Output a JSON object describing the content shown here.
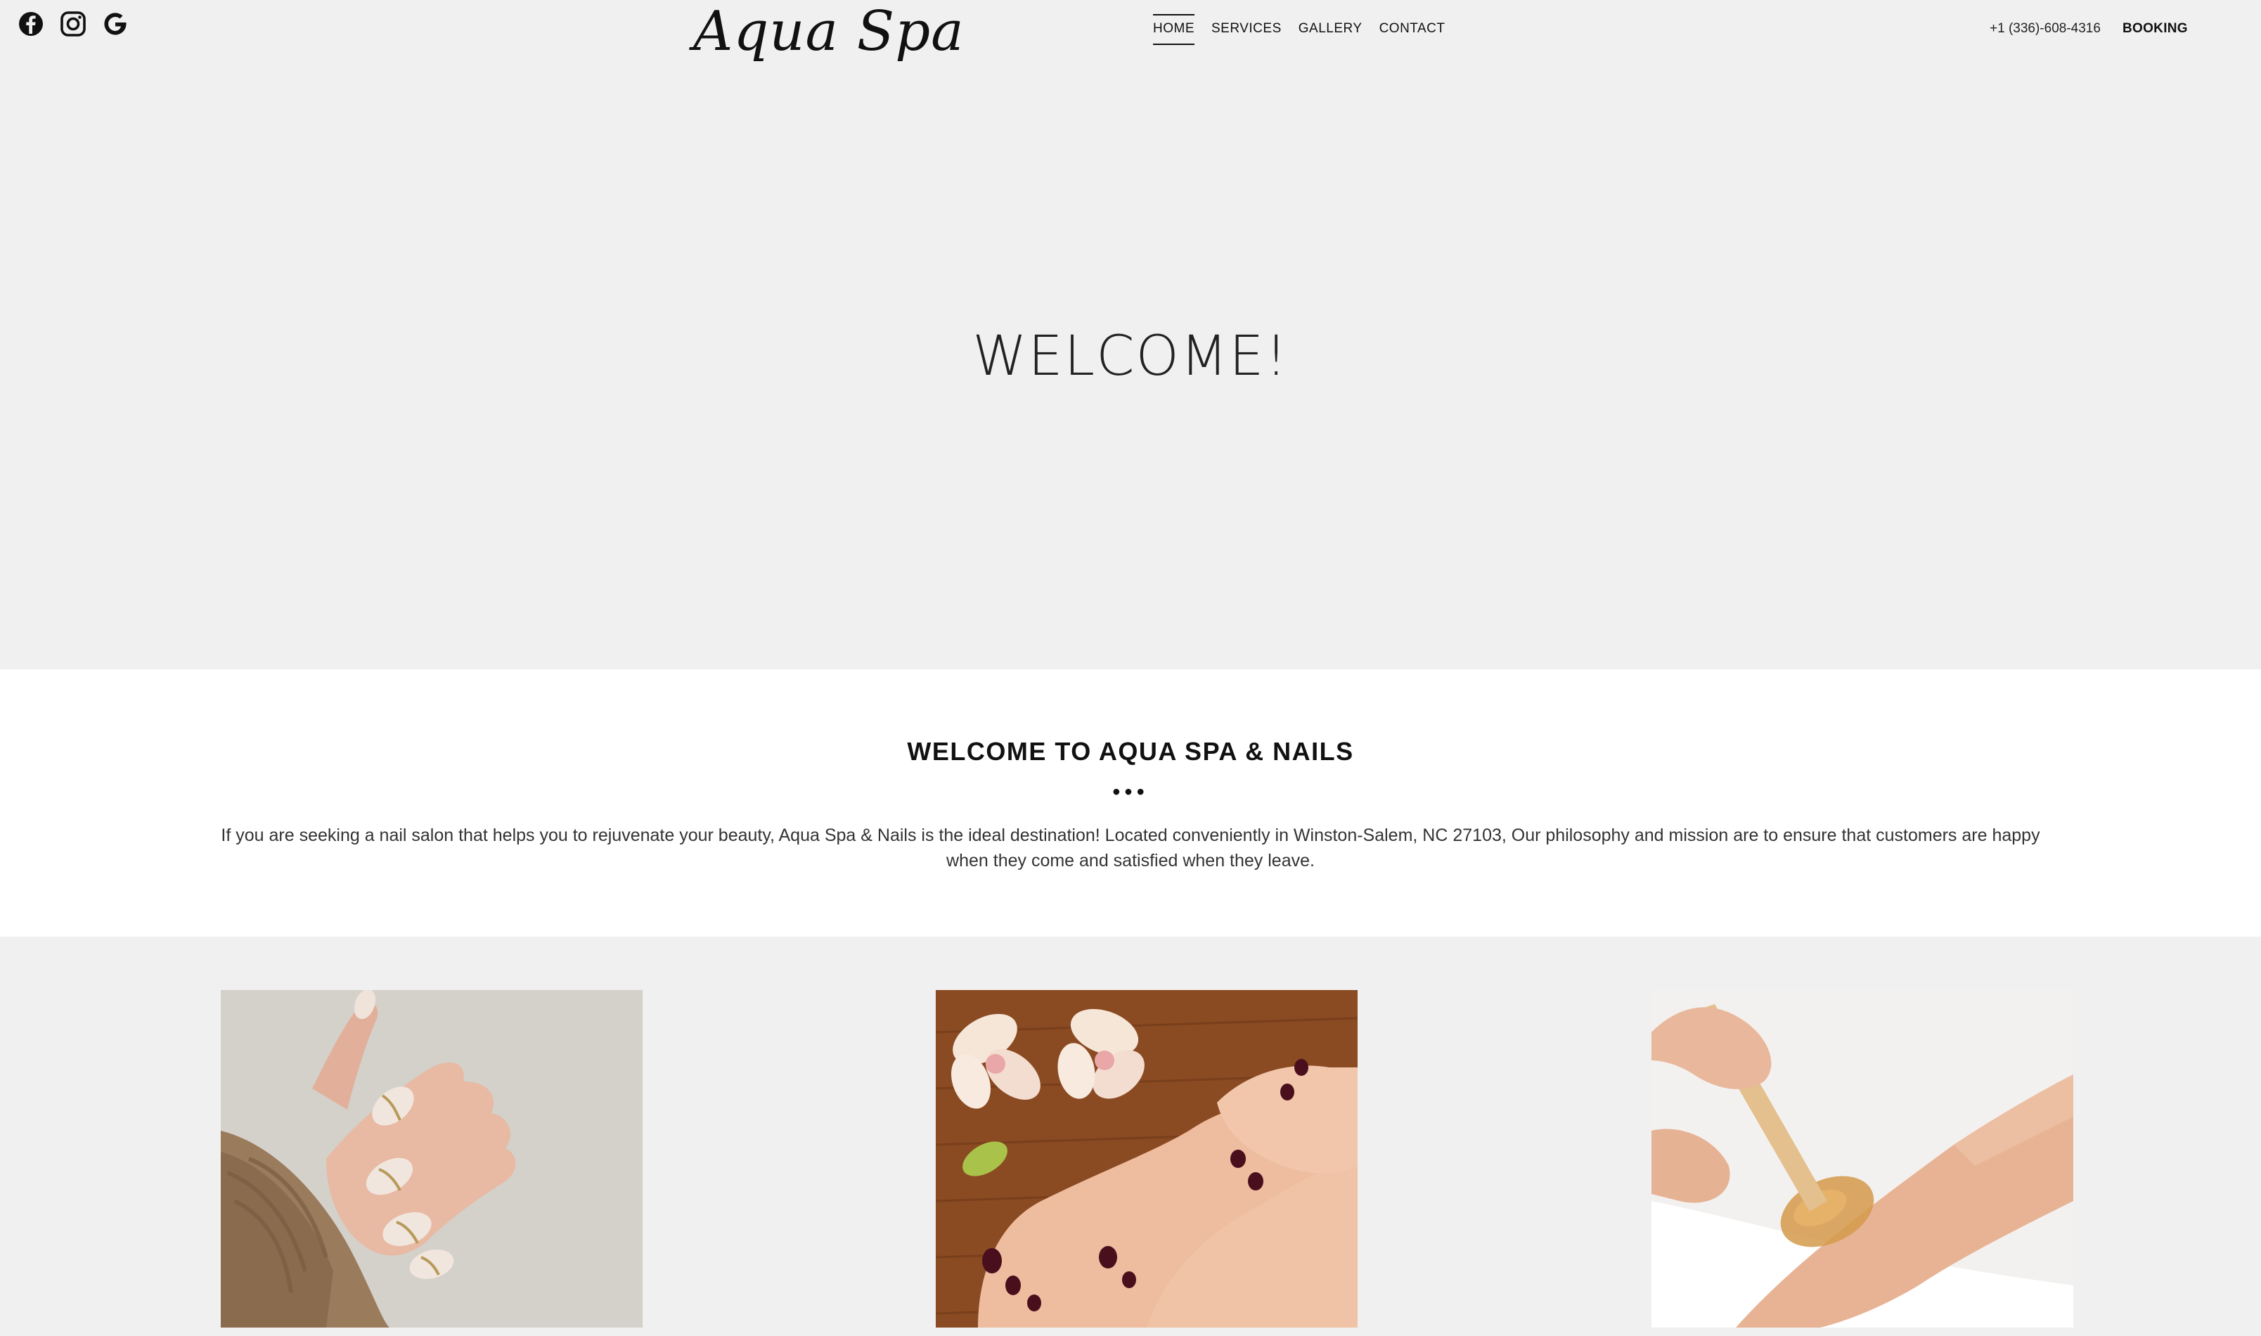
{
  "header": {
    "social_icons": [
      "facebook-icon",
      "instagram-icon",
      "google-icon"
    ],
    "logo": "Aqua Spa",
    "nav": [
      {
        "label": "HOME",
        "active": true
      },
      {
        "label": "SERVICES",
        "active": false
      },
      {
        "label": "GALLERY",
        "active": false
      },
      {
        "label": "CONTACT",
        "active": false
      }
    ],
    "phone": "+1 (336)-608-4316",
    "booking": "BOOKING"
  },
  "hero": {
    "title": "WELCOME!"
  },
  "intro": {
    "title": "WELCOME TO AQUA SPA & NAILS",
    "dots": "•••",
    "text": "If you are seeking a nail salon that helps you to rejuvenate your beauty, Aqua Spa & Nails is the ideal destination! Located conveniently in Winston-Salem, NC 27103, Our philosophy and mission are to ensure that customers are happy when they come and satisfied when they leave."
  },
  "services": {
    "images": [
      "manicure-photo",
      "pedicure-photo",
      "waxing-photo"
    ]
  },
  "colors": {
    "page_bg": "#f0f0f0",
    "section_bg": "#ffffff",
    "text": "#111111"
  }
}
